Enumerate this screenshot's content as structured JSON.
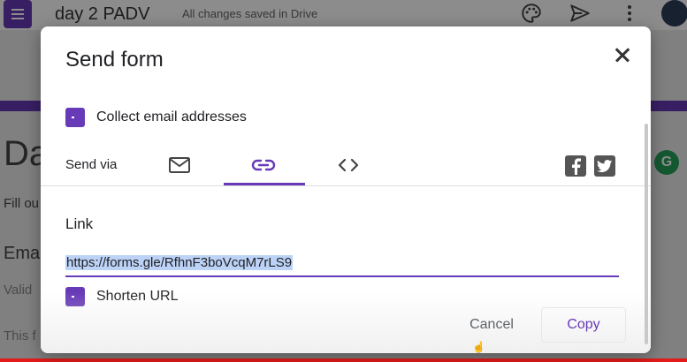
{
  "app": {
    "doc_title": "day 2 PADV",
    "save_status": "All changes saved in Drive",
    "bg_heading": "Da",
    "bg_fill": "Fill ou",
    "bg_email": "Ema",
    "bg_valid": "Valid",
    "bg_this": "This f",
    "g_badge": "G"
  },
  "dialog": {
    "title": "Send form",
    "collect_email_label": "Collect email addresses",
    "collect_email_checked": true,
    "send_via_label": "Send via",
    "tabs": [
      {
        "name": "email",
        "icon": "mail-icon"
      },
      {
        "name": "link",
        "icon": "link-icon",
        "selected": true
      },
      {
        "name": "embed",
        "icon": "embed-code-icon"
      }
    ],
    "social": [
      "facebook-icon",
      "twitter-icon"
    ],
    "link_heading": "Link",
    "url": "https://forms.gle/RfhnF3boVcqM7rLS9",
    "shorten_url_label": "Shorten URL",
    "shorten_url_checked": true,
    "cancel_label": "Cancel",
    "copy_label": "Copy"
  },
  "colors": {
    "accent": "#673ab7",
    "selection": "#bcd3f7"
  }
}
